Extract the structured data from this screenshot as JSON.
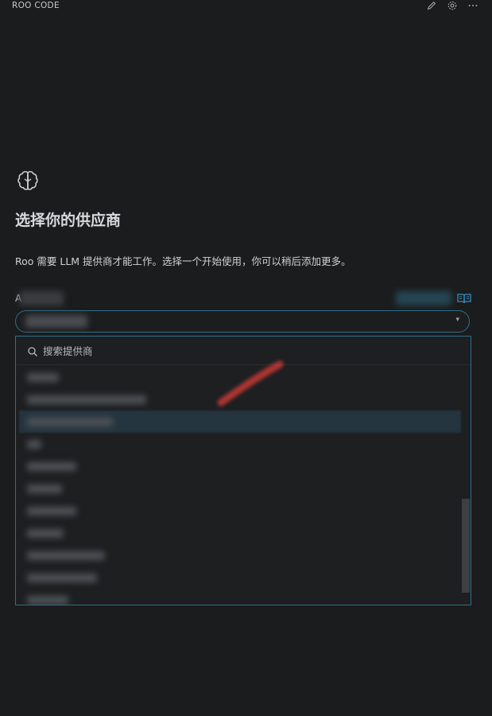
{
  "app": {
    "title": "ROO CODE"
  },
  "toolbar": {
    "icons": [
      "pencil-icon",
      "gear-icon",
      "more-icon"
    ]
  },
  "welcome": {
    "heading": "选择你的供应商",
    "description": "Roo 需要 LLM 提供商才能工作。选择一个开始使用，你可以稍后添加更多。"
  },
  "provider_field": {
    "label_initial": "A"
  },
  "dropdown": {
    "search_placeholder": "搜索提供商",
    "items": [
      {
        "selected": false
      },
      {
        "selected": false
      },
      {
        "selected": true
      },
      {
        "selected": false
      },
      {
        "selected": false
      },
      {
        "selected": false
      },
      {
        "selected": false
      },
      {
        "selected": false
      },
      {
        "selected": false
      },
      {
        "selected": false
      },
      {
        "selected": false
      }
    ]
  },
  "colors": {
    "accent": "#2f6e8a",
    "background": "#1b1c1d",
    "selected_row": "#24353f",
    "link_icon": "#3a8dc0"
  }
}
